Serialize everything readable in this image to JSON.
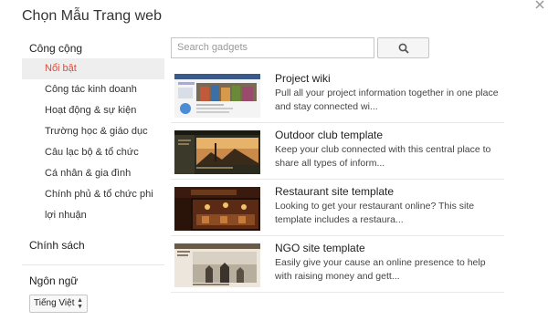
{
  "dialog": {
    "title": "Chọn Mẫu Trang web"
  },
  "sidebar": {
    "section_label": "Công cộng",
    "items": [
      {
        "label": "Nổi bật",
        "active": true
      },
      {
        "label": "Công tác kinh doanh"
      },
      {
        "label": "Hoạt động & sự kiện"
      },
      {
        "label": "Trường học & giáo dục"
      },
      {
        "label": "Câu lạc bộ & tổ chức"
      },
      {
        "label": "Cá nhân & gia đình"
      },
      {
        "label": "Chính phủ & tổ chức phi lợi nhuận"
      }
    ],
    "policy_label": "Chính sách",
    "language_label": "Ngôn ngữ",
    "language_value": "Tiếng Việt"
  },
  "search": {
    "placeholder": "Search gadgets",
    "button_icon": "search-icon"
  },
  "results": [
    {
      "title": "Project wiki",
      "description": "Pull all your project information together in one place and stay connected wi..."
    },
    {
      "title": "Outdoor club template",
      "description": "Keep your club connected with this central place to share all types of inform..."
    },
    {
      "title": "Restaurant site template",
      "description": "Looking to get your restaurant online? This site template includes a restaura..."
    },
    {
      "title": "NGO site template",
      "description": "Easily give your cause an online presence to help with raising money and gett..."
    }
  ],
  "colors": {
    "active_text": "#dd4b39",
    "active_bg": "#eeeeee"
  }
}
